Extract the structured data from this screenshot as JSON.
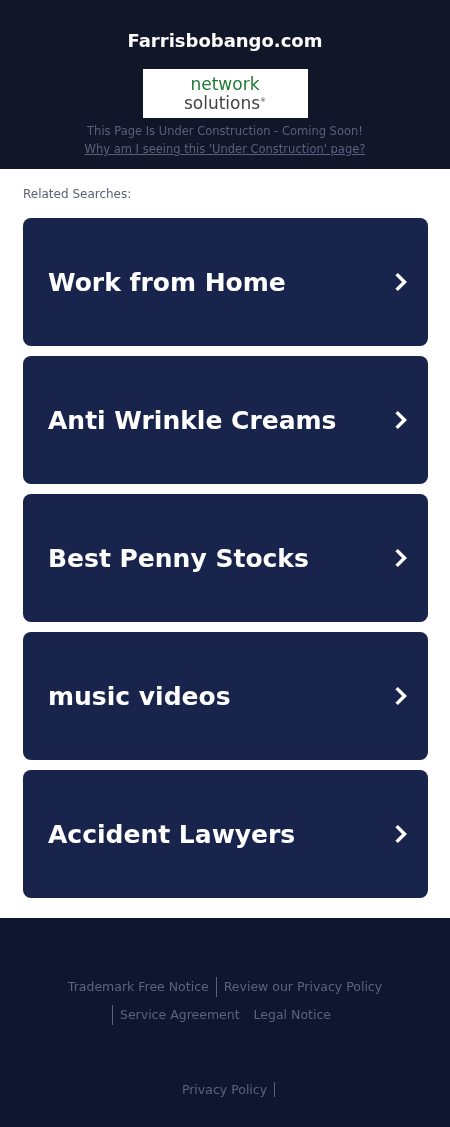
{
  "header": {
    "domain": "Farrisbobango.com",
    "logo": {
      "line1": "network",
      "line2": "solutions$^{®}$"
    },
    "notice": "This Page Is Under Construction - Coming Soon!",
    "why_link": "Why am I seeing this 'Under Construction' page?"
  },
  "related": {
    "heading": "Related Searches:",
    "items": [
      {
        "label": "Work from Home"
      },
      {
        "label": "Anti Wrinkle Creams"
      },
      {
        "label": "Best Penny Stocks"
      },
      {
        "label": "music videos"
      },
      {
        "label": "Accident Lawyers"
      }
    ]
  },
  "footer": {
    "links": [
      {
        "label": "Trademark Free Notice",
        "divider": false
      },
      {
        "label": "Review our Privacy Policy",
        "divider": true
      },
      {
        "label": "Service Agreement",
        "divider": true
      },
      {
        "label": "Legal Notice",
        "divider": false
      }
    ],
    "bottom_link": {
      "label": "Privacy Policy",
      "divider": true
    }
  }
}
